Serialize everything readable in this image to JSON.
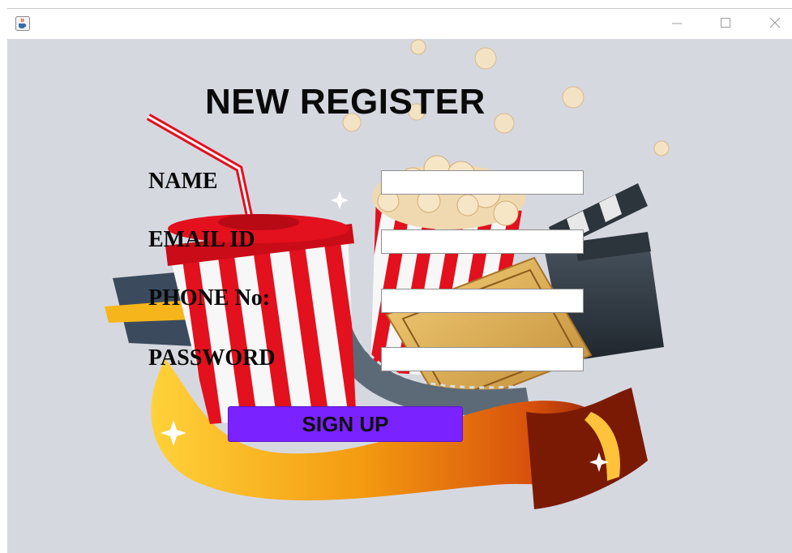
{
  "window": {
    "app_icon": "java-coffee-cup-icon",
    "controls": {
      "minimize_icon": "minimize-icon",
      "maximize_icon": "maximize-icon",
      "close_icon": "close-icon"
    }
  },
  "form": {
    "title": "NEW REGISTER",
    "fields": [
      {
        "label": "NAME",
        "value": "",
        "placeholder": ""
      },
      {
        "label": "EMAIL ID",
        "value": "",
        "placeholder": ""
      },
      {
        "label": "PHONE No:",
        "value": "",
        "placeholder": ""
      },
      {
        "label": "PASSWORD",
        "value": "",
        "placeholder": ""
      }
    ],
    "submit_label": "SIGN UP"
  },
  "background_art": {
    "description_icons": [
      "soda-cup-icon",
      "popcorn-box-icon",
      "movie-ticket-icon",
      "clapperboard-icon",
      "film-reel-icon",
      "ribbon-banner-icon"
    ]
  },
  "colors": {
    "background": "#d6d8e0",
    "signup_button": "#7a22ff",
    "cup_red": "#e3101e",
    "ribbon_gold": "#f2a81c"
  }
}
